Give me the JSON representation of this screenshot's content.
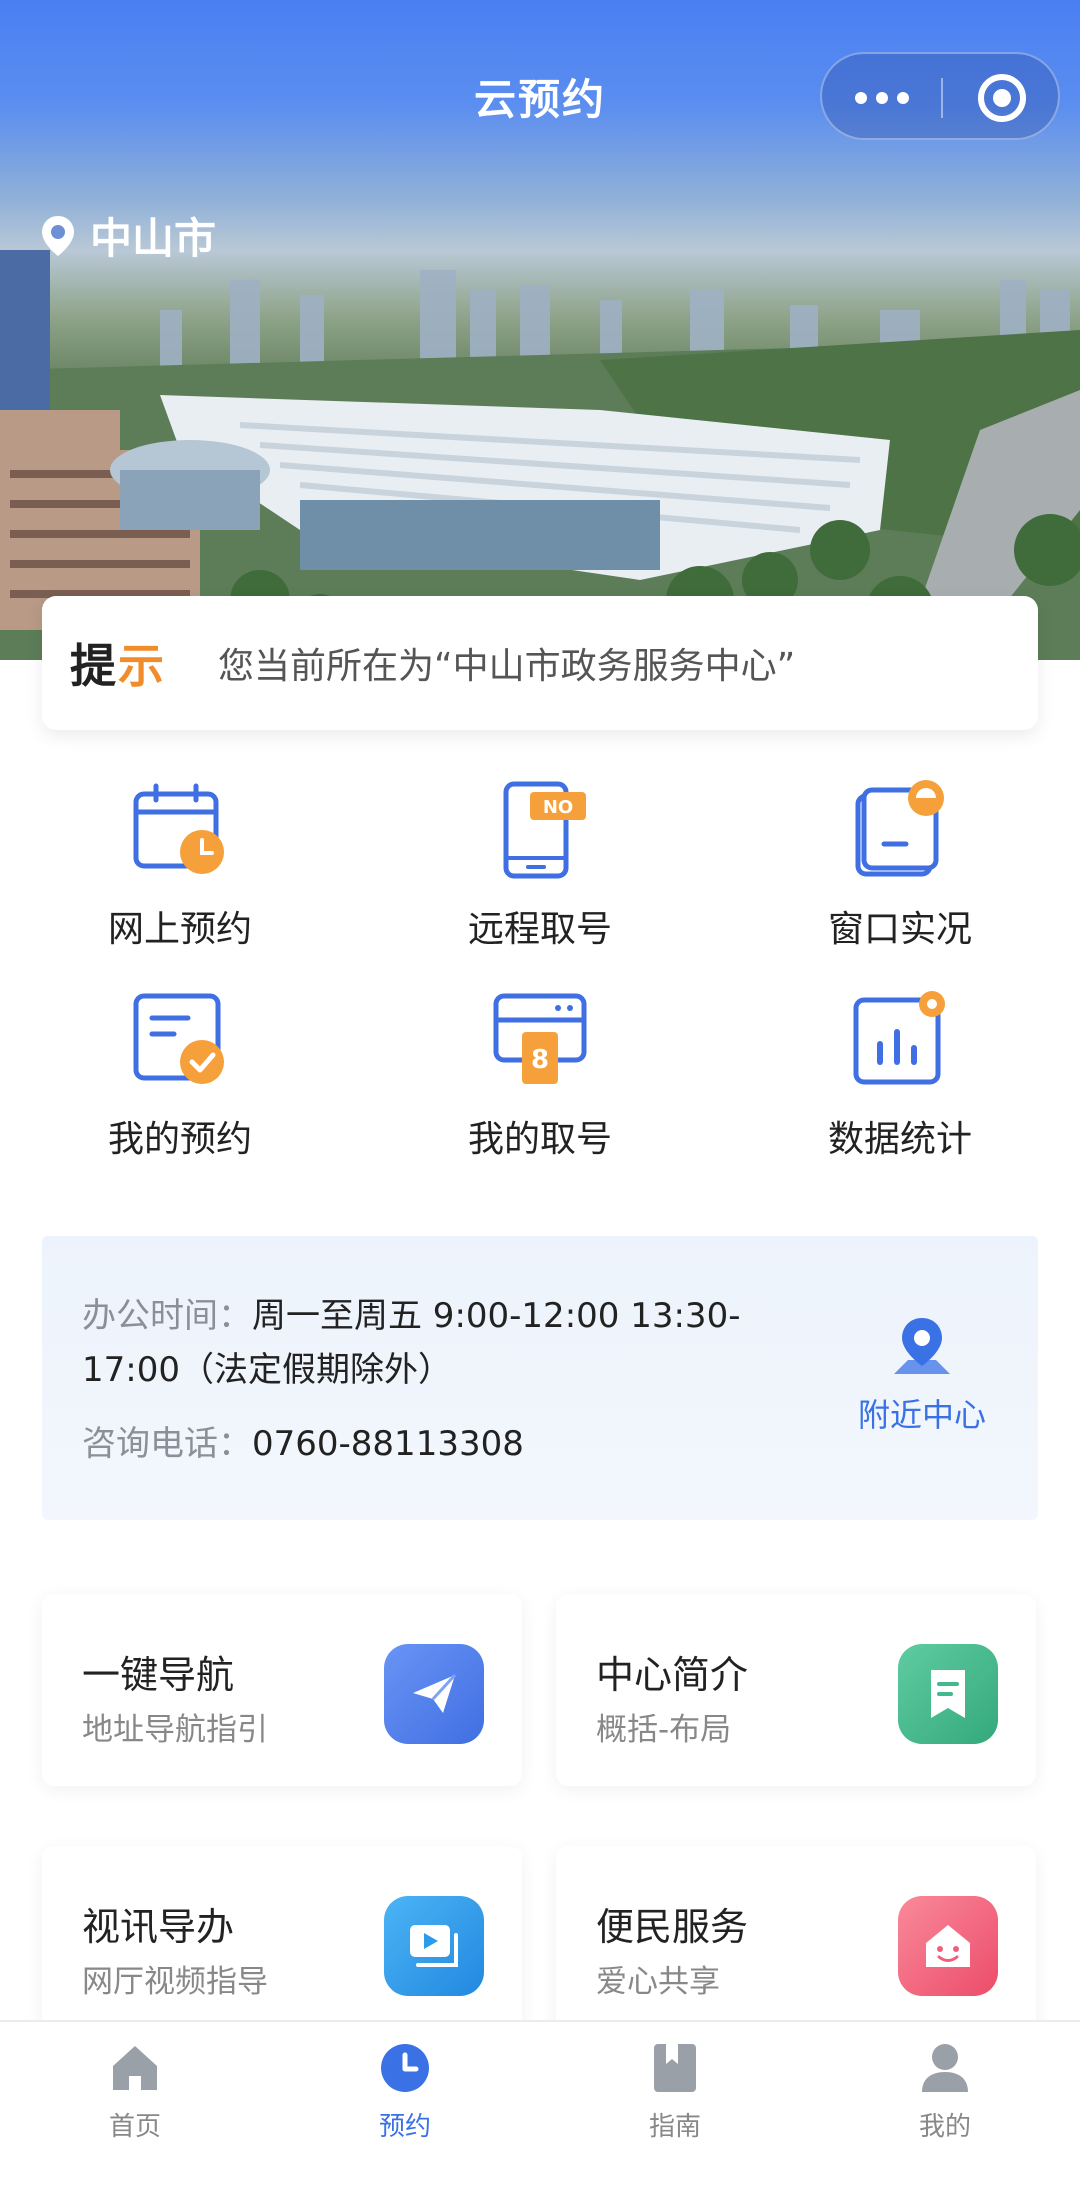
{
  "header": {
    "title": "云预约"
  },
  "location": {
    "city": "中山市"
  },
  "notice": {
    "tag_main": "提",
    "tag_accent": "示",
    "text": "您当前所在为“中山市政务服务中心”"
  },
  "grid": [
    {
      "label": "网上预约",
      "icon": "calendar-clock-icon"
    },
    {
      "label": "远程取号",
      "icon": "phone-ticket-icon",
      "badge": "NO"
    },
    {
      "label": "窗口实况",
      "icon": "window-live-icon"
    },
    {
      "label": "我的预约",
      "icon": "form-check-icon"
    },
    {
      "label": "我的取号",
      "icon": "number-ticket-icon",
      "badge": "8"
    },
    {
      "label": "数据统计",
      "icon": "bar-chart-icon"
    }
  ],
  "info": {
    "hours_label": "办公时间：",
    "hours_value_1": "周一至周五 9:00-12:00 13:30-",
    "hours_value_2": "17:00（法定假期除外）",
    "phone_label": "咨询电话：",
    "phone_value": "0760-88113308",
    "nearby_label": "附近中心"
  },
  "cards": [
    {
      "title": "一键导航",
      "subtitle": "地址导航指引",
      "icon": "paper-plane-icon",
      "color": "#4f7ef0"
    },
    {
      "title": "中心简介",
      "subtitle": "概括-布局",
      "icon": "bookmark-icon",
      "color": "#43b88c"
    },
    {
      "title": "视讯导办",
      "subtitle": "网厅视频指导",
      "icon": "video-play-icon",
      "color": "#2b9bea"
    },
    {
      "title": "便民服务",
      "subtitle": "爱心共享",
      "icon": "smile-house-icon",
      "color": "#f0607a"
    }
  ],
  "tabbar": [
    {
      "label": "首页",
      "icon": "home-icon",
      "active": false
    },
    {
      "label": "预约",
      "icon": "clock-icon",
      "active": true
    },
    {
      "label": "指南",
      "icon": "book-icon",
      "active": false
    },
    {
      "label": "我的",
      "icon": "user-icon",
      "active": false
    }
  ],
  "colors": {
    "accent": "#3a72e6",
    "orange": "#f08c2a",
    "icon_blue": "#3f6fe2"
  }
}
